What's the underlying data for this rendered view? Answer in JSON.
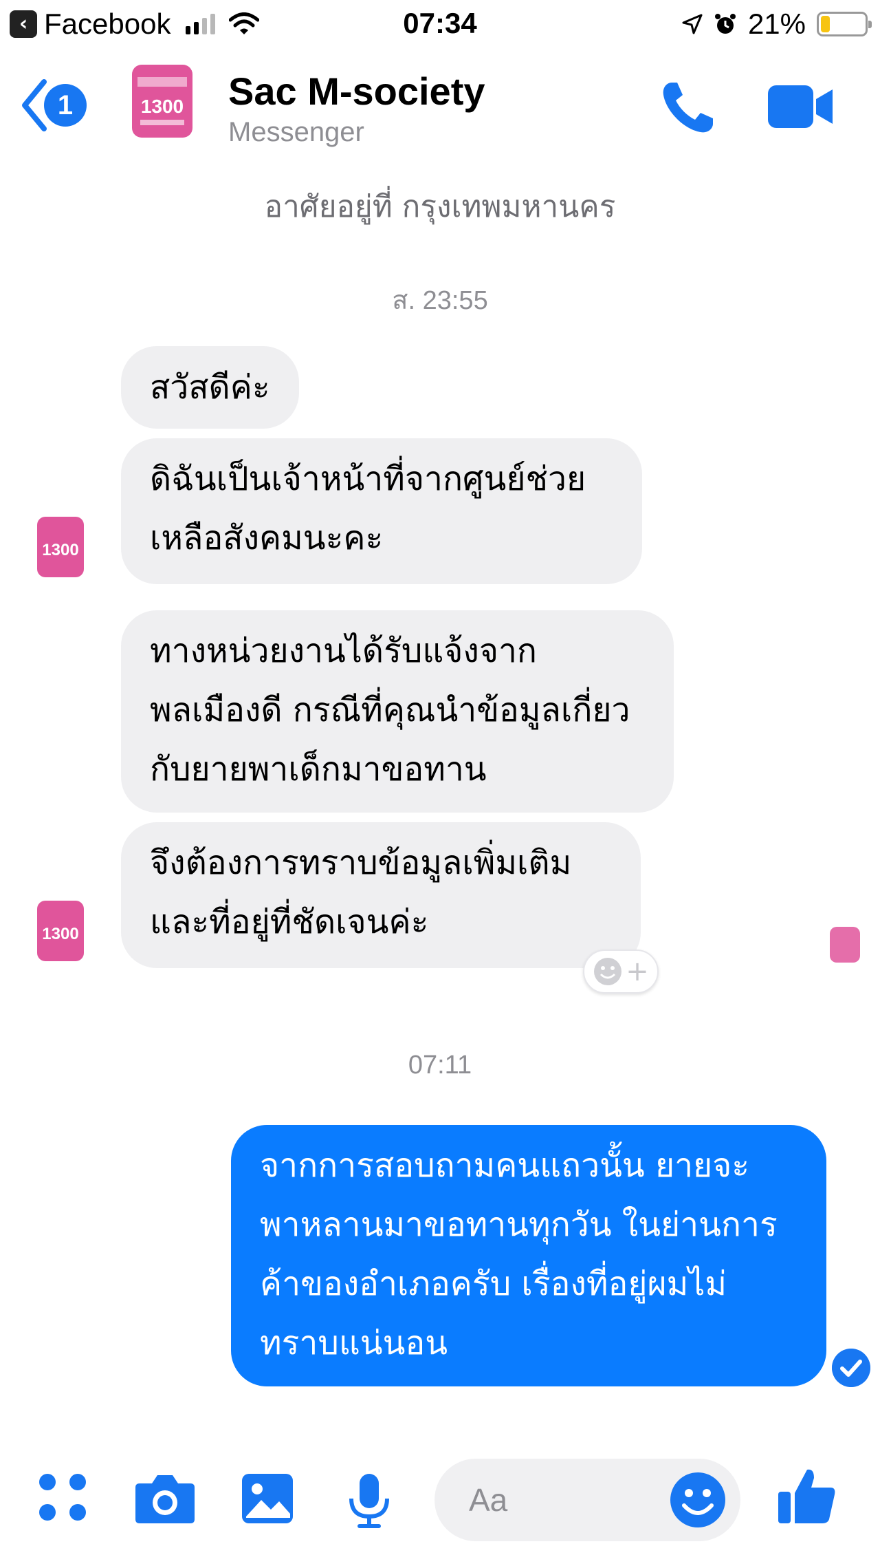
{
  "status_bar": {
    "back_app": "Facebook",
    "time": "07:34",
    "battery": "21%",
    "battery_level": 0.21
  },
  "header": {
    "title": "Sac M-society",
    "subtitle": "Messenger",
    "unread_count": "1",
    "avatar_number": "1300"
  },
  "thread": {
    "partial_top": "อาศัยอยู่ที่ กรุงเทพมหานคร",
    "ts1": "ส. 23:55",
    "ts2": "07:11",
    "messages": [
      {
        "text": "สวัสดีค่ะ"
      },
      {
        "text": "ดิฉันเป็นเจ้าหน้าที่จากศูนย์ช่วยเหลือสังคมนะคะ"
      },
      {
        "text": "ทางหน่วยงานได้รับแจ้งจากพลเมืองดี กรณีที่คุณนำข้อมูลเกี่ยวกับยายพาเด็กมาขอทาน"
      },
      {
        "text": "จึงต้องการทราบข้อมูลเพิ่มเติมและที่อยู่ที่ชัดเจนค่ะ"
      },
      {
        "text": "จากการสอบถามคนแถวนั้น ยายจะพาหลานมาขอทานทุกวัน ในย่านการค้าของอำเภอครับ เรื่องที่อยู่ผมไม่ทราบแน่นอน"
      }
    ]
  },
  "composer": {
    "placeholder": "Aa"
  },
  "colors": {
    "brand_blue": "#0a7cff",
    "icon_blue": "#1877f2",
    "incoming_bubble": "#efeff1",
    "avatar_pink": "#e0559b"
  },
  "icons": {
    "status_bar": [
      "back-app-icon",
      "signal-icon",
      "wifi-icon",
      "location-icon",
      "alarm-icon",
      "battery-icon"
    ],
    "header": [
      "back-chevron-icon",
      "phone-icon",
      "video-camera-icon"
    ],
    "composer": [
      "apps-icon",
      "camera-icon",
      "image-icon",
      "microphone-icon",
      "emoji-icon",
      "thumbs-up-icon"
    ]
  }
}
